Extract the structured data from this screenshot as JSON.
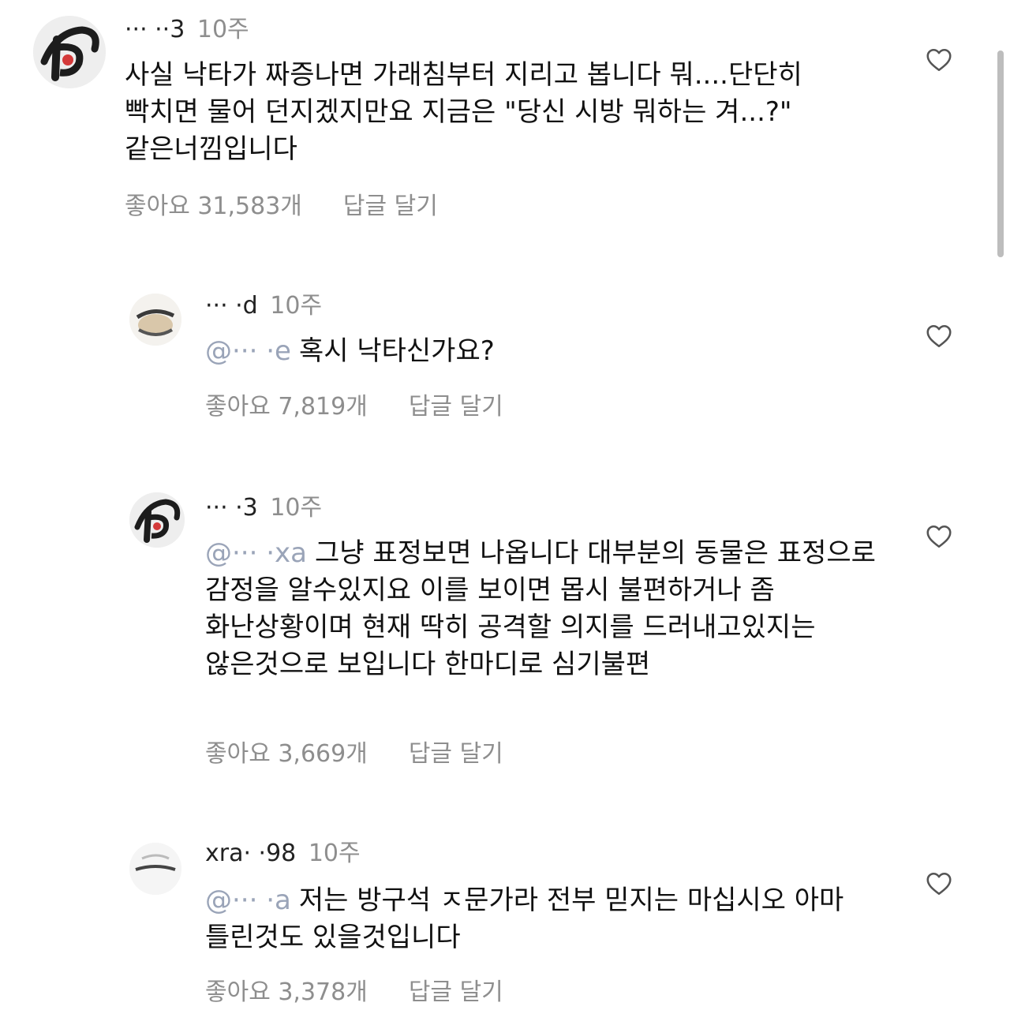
{
  "comments": [
    {
      "username": "··· ··3",
      "time": "10주",
      "mention": "",
      "text": "사실 낙타가 짜증나면 가래침부터 지리고 봅니다 뭐....단단히 빡치면 물어 던지겠지만요 지금은 \"당신 시방 뭐하는 겨...?\" 같은너낌입니다",
      "likes": "좋아요 31,583개",
      "reply": "답글 달기"
    },
    {
      "username": "··· ·d",
      "time": "10주",
      "mention": "@··· ·e",
      "text": "혹시 낙타신가요?",
      "likes": "좋아요 7,819개",
      "reply": "답글 달기"
    },
    {
      "username": "··· ·3",
      "time": "10주",
      "mention": "@··· ·xa",
      "text": "그냥 표정보면 나옵니다 대부분의 동물은 표정으로 감정을 알수있지요 이를 보이면 몹시 불편하거나 좀 화난상황이며 현재 딱히 공격할 의지를 드러내고있지는 않은것으로 보입니다 한마디로 심기불편",
      "likes": "좋아요 3,669개",
      "reply": "답글 달기"
    },
    {
      "username": "xra· ·98",
      "time": "10주",
      "mention": "@··· ·a",
      "text": "저는 방구석 ㅈ문가라 전부 믿지는 마십시오 아마 틀린것도 있을것입니다",
      "likes": "좋아요 3,378개",
      "reply": "답글 달기"
    }
  ],
  "colors": {
    "text": "#111111",
    "secondary": "#8e8e8e",
    "mention": "#9aa4b8",
    "scrollbar": "#bdbdbd"
  },
  "icons": {
    "like": "heart-outline-icon",
    "avatar": "user-avatar"
  }
}
